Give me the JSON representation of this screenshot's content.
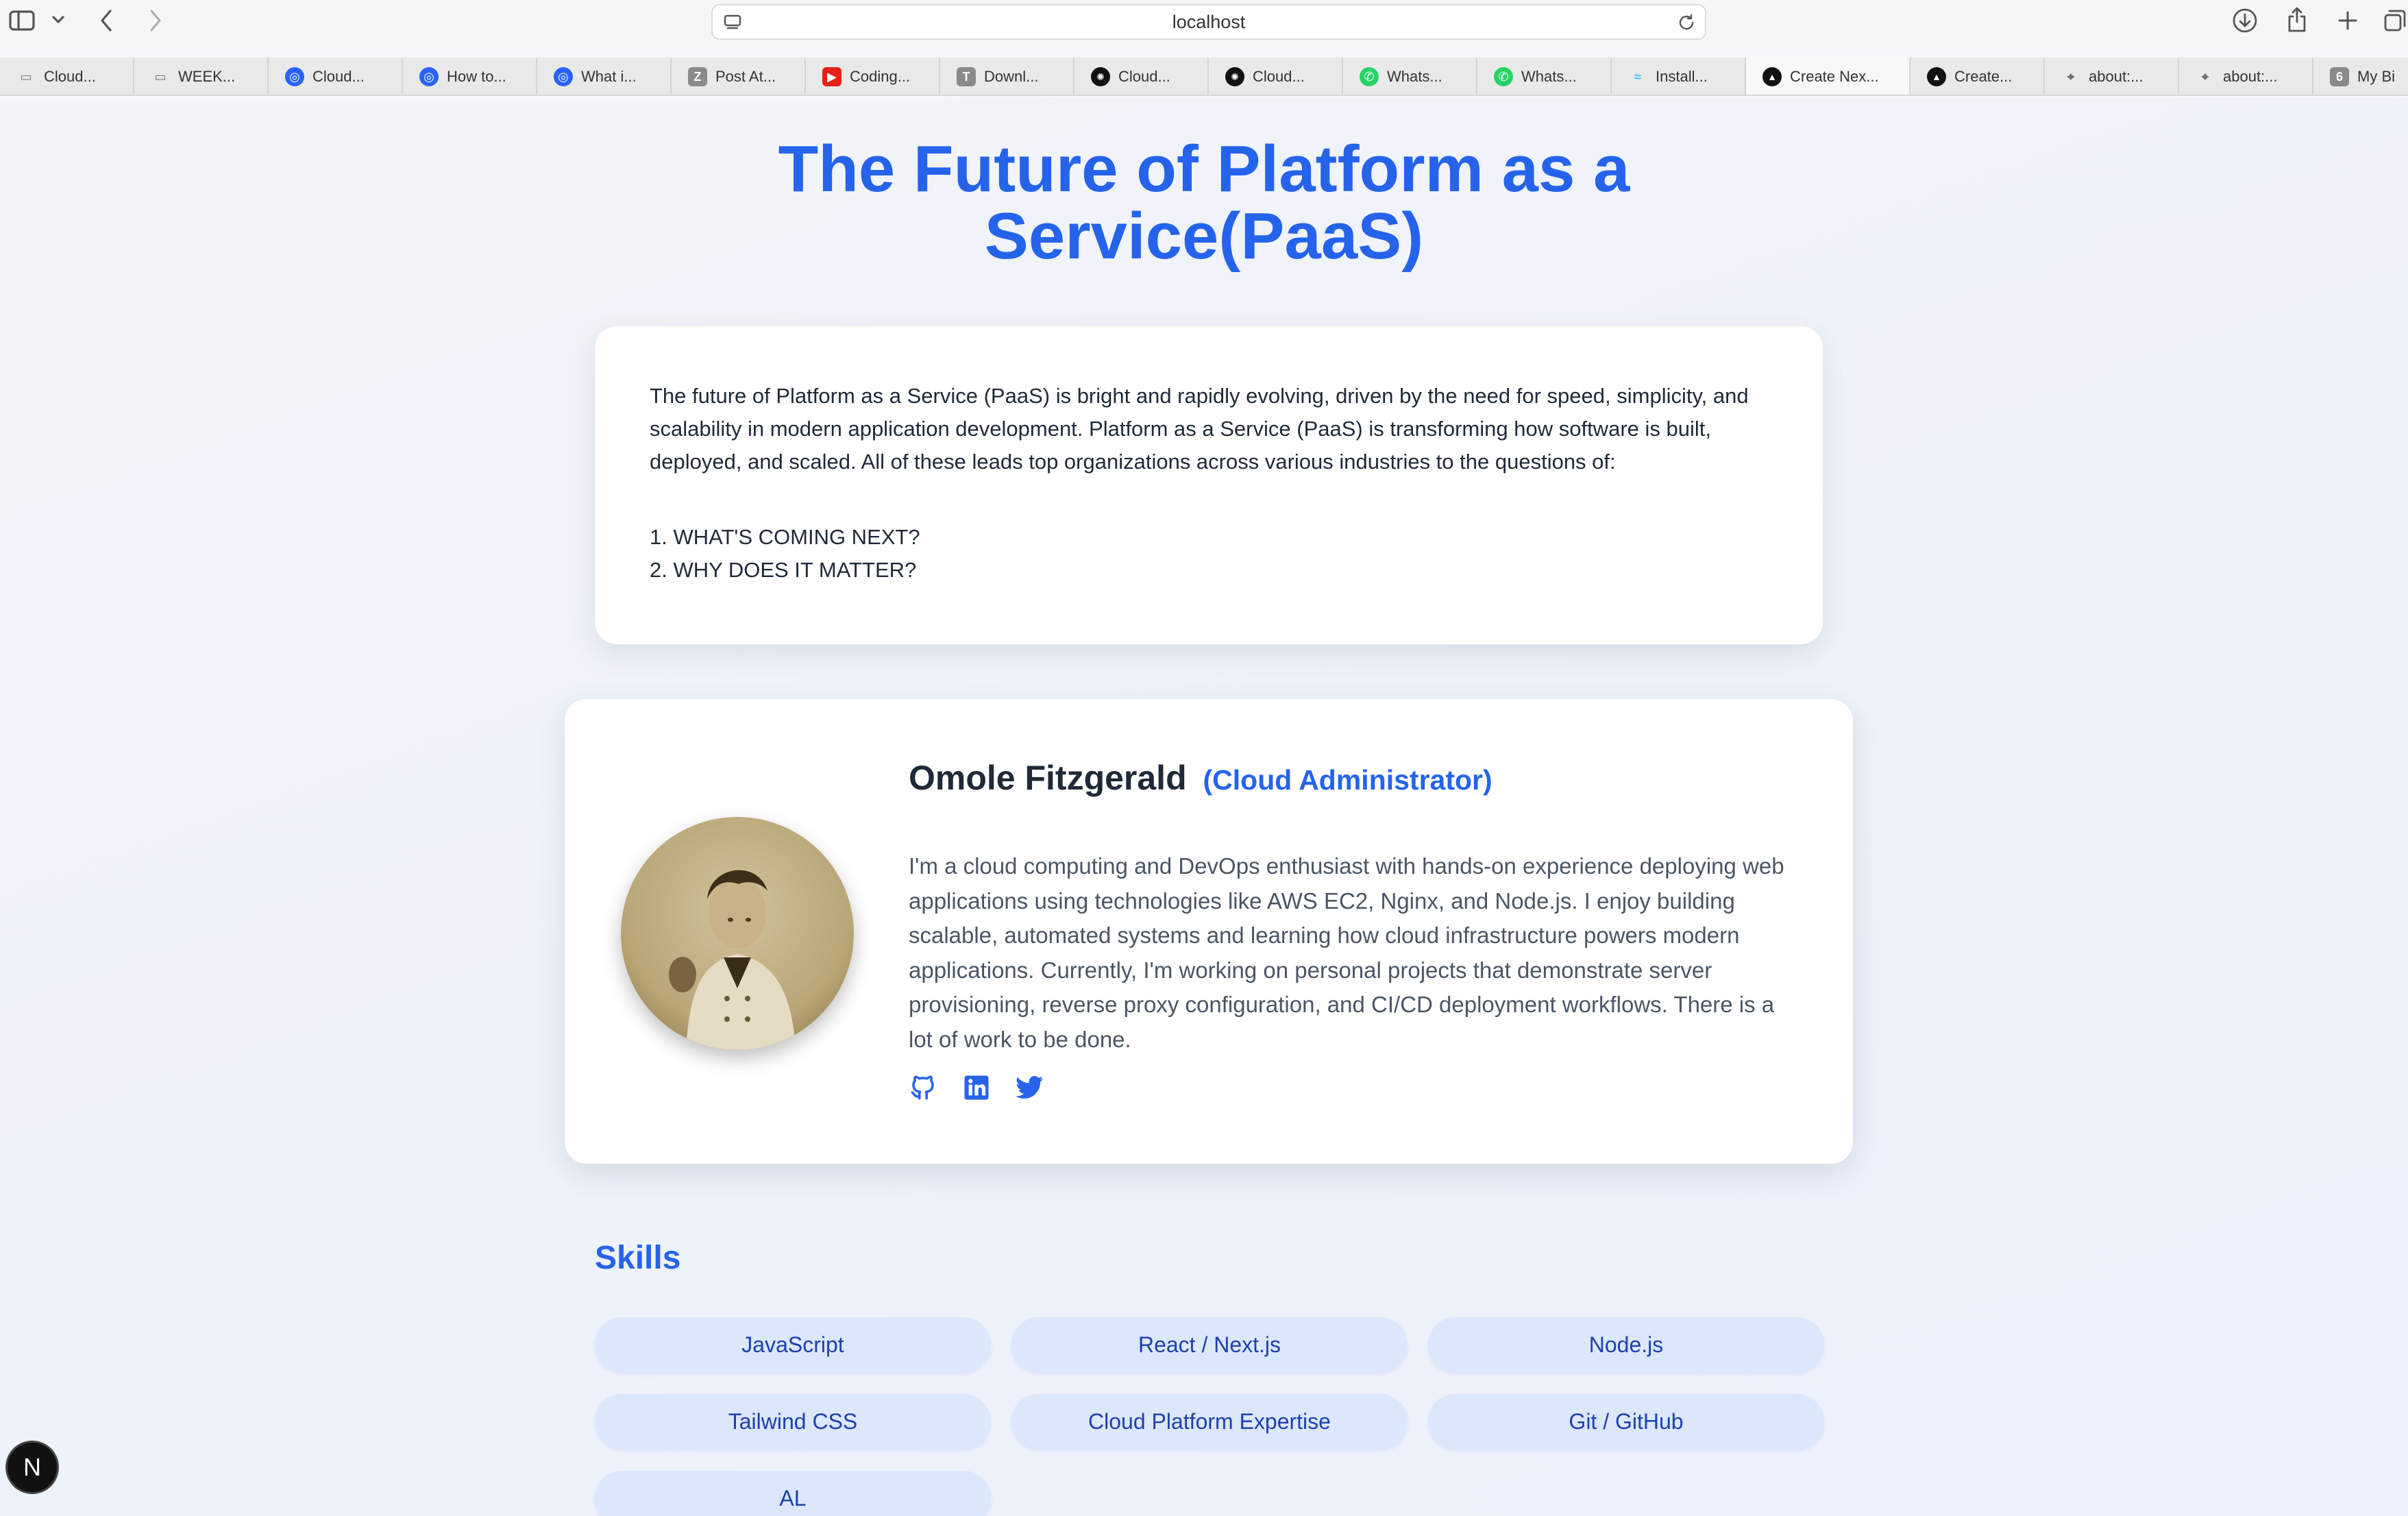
{
  "browser": {
    "url": "localhost",
    "tabs": [
      {
        "label": "Cloud...",
        "icon": "folder-icon",
        "color": "#777777",
        "active": false
      },
      {
        "label": "WEEK...",
        "icon": "folder-icon",
        "color": "#777777",
        "active": false
      },
      {
        "label": "Cloud...",
        "icon": "hashnode-icon",
        "color": "#2962ff",
        "active": false
      },
      {
        "label": "How to...",
        "icon": "hashnode-icon",
        "color": "#2962ff",
        "active": false
      },
      {
        "label": "What i...",
        "icon": "hashnode-icon",
        "color": "#2962ff",
        "active": false
      },
      {
        "label": "Post At...",
        "icon": "z-letter-icon",
        "color": "#8a8a8a",
        "active": false
      },
      {
        "label": "Coding...",
        "icon": "youtube-icon",
        "color": "#e62117",
        "active": false
      },
      {
        "label": "Downl...",
        "icon": "t-letter-icon",
        "color": "#8a8a8a",
        "active": false
      },
      {
        "label": "Cloud...",
        "icon": "chatgpt-icon",
        "color": "#111111",
        "active": false
      },
      {
        "label": "Cloud...",
        "icon": "chatgpt-icon",
        "color": "#111111",
        "active": false
      },
      {
        "label": "Whats...",
        "icon": "whatsapp-icon",
        "color": "#25d366",
        "active": false
      },
      {
        "label": "Whats...",
        "icon": "whatsapp-icon",
        "color": "#25d366",
        "active": false
      },
      {
        "label": "Install...",
        "icon": "tailwind-icon",
        "color": "#38bdf8",
        "active": false
      },
      {
        "label": "Create Nex...",
        "icon": "vercel-icon",
        "color": "#111111",
        "active": true
      },
      {
        "label": "Create...",
        "icon": "vercel-icon",
        "color": "#111111",
        "active": false
      },
      {
        "label": "about:...",
        "icon": "compass-icon",
        "color": "#666666",
        "active": false
      },
      {
        "label": "about:...",
        "icon": "compass-icon",
        "color": "#666666",
        "active": false
      },
      {
        "label": "My Bi",
        "icon": "six-letter-icon",
        "color": "#8a8a8a",
        "active": false
      }
    ]
  },
  "page": {
    "title_line1": "The Future of Platform as a",
    "title_line2": "Service(PaaS)",
    "intro": {
      "text": "The future of Platform as a Service (PaaS) is bright and rapidly evolving, driven by the need for speed, simplicity, and scalability in modern application development. Platform as a Service (PaaS) is transforming how software is built, deployed, and scaled. All of these leads top organizations across various industries to the questions of:",
      "questions": [
        "1. WHAT'S COMING NEXT?",
        "2. WHY DOES IT MATTER?"
      ]
    },
    "profile": {
      "name": "Omole Fitzgerald",
      "role": "(Cloud Administrator)",
      "bio": "I'm a cloud computing and DevOps enthusiast with hands-on experience deploying web applications using technologies like AWS EC2, Nginx, and Node.js. I enjoy building scalable, automated systems and learning how cloud infrastructure powers modern applications. Currently, I'm working on personal projects that demonstrate server provisioning, reverse proxy configuration, and CI/CD deployment workflows. There is a lot of work to be done.",
      "socials": [
        "github-icon",
        "linkedin-icon",
        "twitter-icon"
      ]
    },
    "skills_heading": "Skills",
    "skills": [
      "JavaScript",
      "React / Next.js",
      "Node.js",
      "Tailwind CSS",
      "Cloud Platform Expertise",
      "Git / GitHub",
      "AL"
    ],
    "dev_badge": "N"
  },
  "colors": {
    "accent": "#2563eb",
    "pill_bg": "#dbe7fb",
    "pill_text": "#1e40af"
  }
}
